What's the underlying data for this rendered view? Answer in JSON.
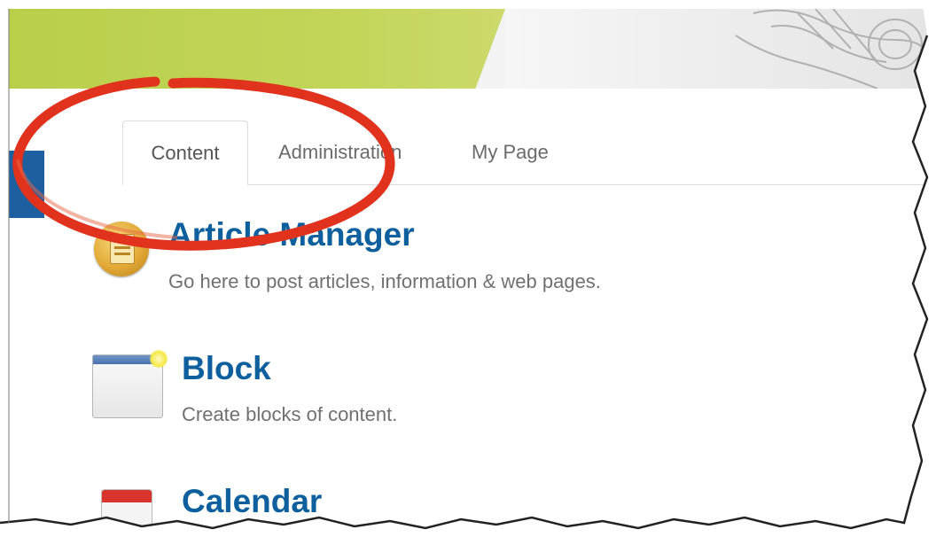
{
  "tabs": [
    {
      "label": "Content",
      "active": true
    },
    {
      "label": "Administration",
      "active": false
    },
    {
      "label": "My Page",
      "active": false
    }
  ],
  "items": [
    {
      "title": "Article Manager",
      "description": "Go here to post articles, information & web pages.",
      "icon": "article-icon"
    },
    {
      "title": "Block",
      "description": "Create blocks of content.",
      "icon": "block-icon"
    },
    {
      "title": "Calendar",
      "description": "",
      "icon": "calendar-icon"
    }
  ],
  "colors": {
    "accent_blue": "#0d5f9d",
    "banner_green": "#c4d55a",
    "annotation_red": "#e0321c"
  }
}
